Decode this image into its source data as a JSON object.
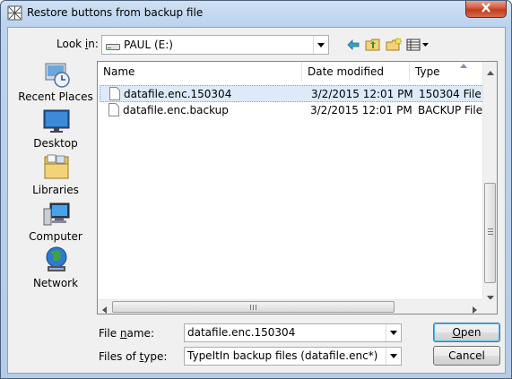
{
  "window": {
    "title": "Restore buttons from backup file"
  },
  "lookin": {
    "label_pre": "Look ",
    "label_key": "i",
    "label_post": "n:",
    "value": "PAUL (E:)"
  },
  "toolbar": {
    "icons": [
      "back-arrow-icon",
      "up-folder-icon",
      "new-folder-icon",
      "view-menu-icon"
    ]
  },
  "places": [
    {
      "label": "Recent Places",
      "icon": "recent-places-icon"
    },
    {
      "label": "Desktop",
      "icon": "desktop-icon"
    },
    {
      "label": "Libraries",
      "icon": "libraries-icon"
    },
    {
      "label": "Computer",
      "icon": "computer-icon"
    },
    {
      "label": "Network",
      "icon": "network-icon"
    }
  ],
  "list": {
    "columns": [
      "Name",
      "Date modified",
      "Type"
    ],
    "rows": [
      {
        "name": "datafile.enc.150304",
        "date": "3/2/2015 12:01 PM",
        "type": "150304 File",
        "selected": true
      },
      {
        "name": "datafile.enc.backup",
        "date": "3/2/2015 12:01 PM",
        "type": "BACKUP File",
        "selected": false
      }
    ]
  },
  "filename": {
    "label_pre": "File ",
    "label_key": "n",
    "label_post": "ame:",
    "value": "datafile.enc.150304"
  },
  "filetype": {
    "label_pre": "Files of ",
    "label_key": "t",
    "label_post": "ype:",
    "value": "TypeItIn backup files (datafile.enc*)"
  },
  "buttons": {
    "open_key": "O",
    "open_rest": "pen",
    "cancel": "Cancel"
  },
  "colors": {
    "selection": "#dceaf9",
    "close": "#c9452a"
  }
}
